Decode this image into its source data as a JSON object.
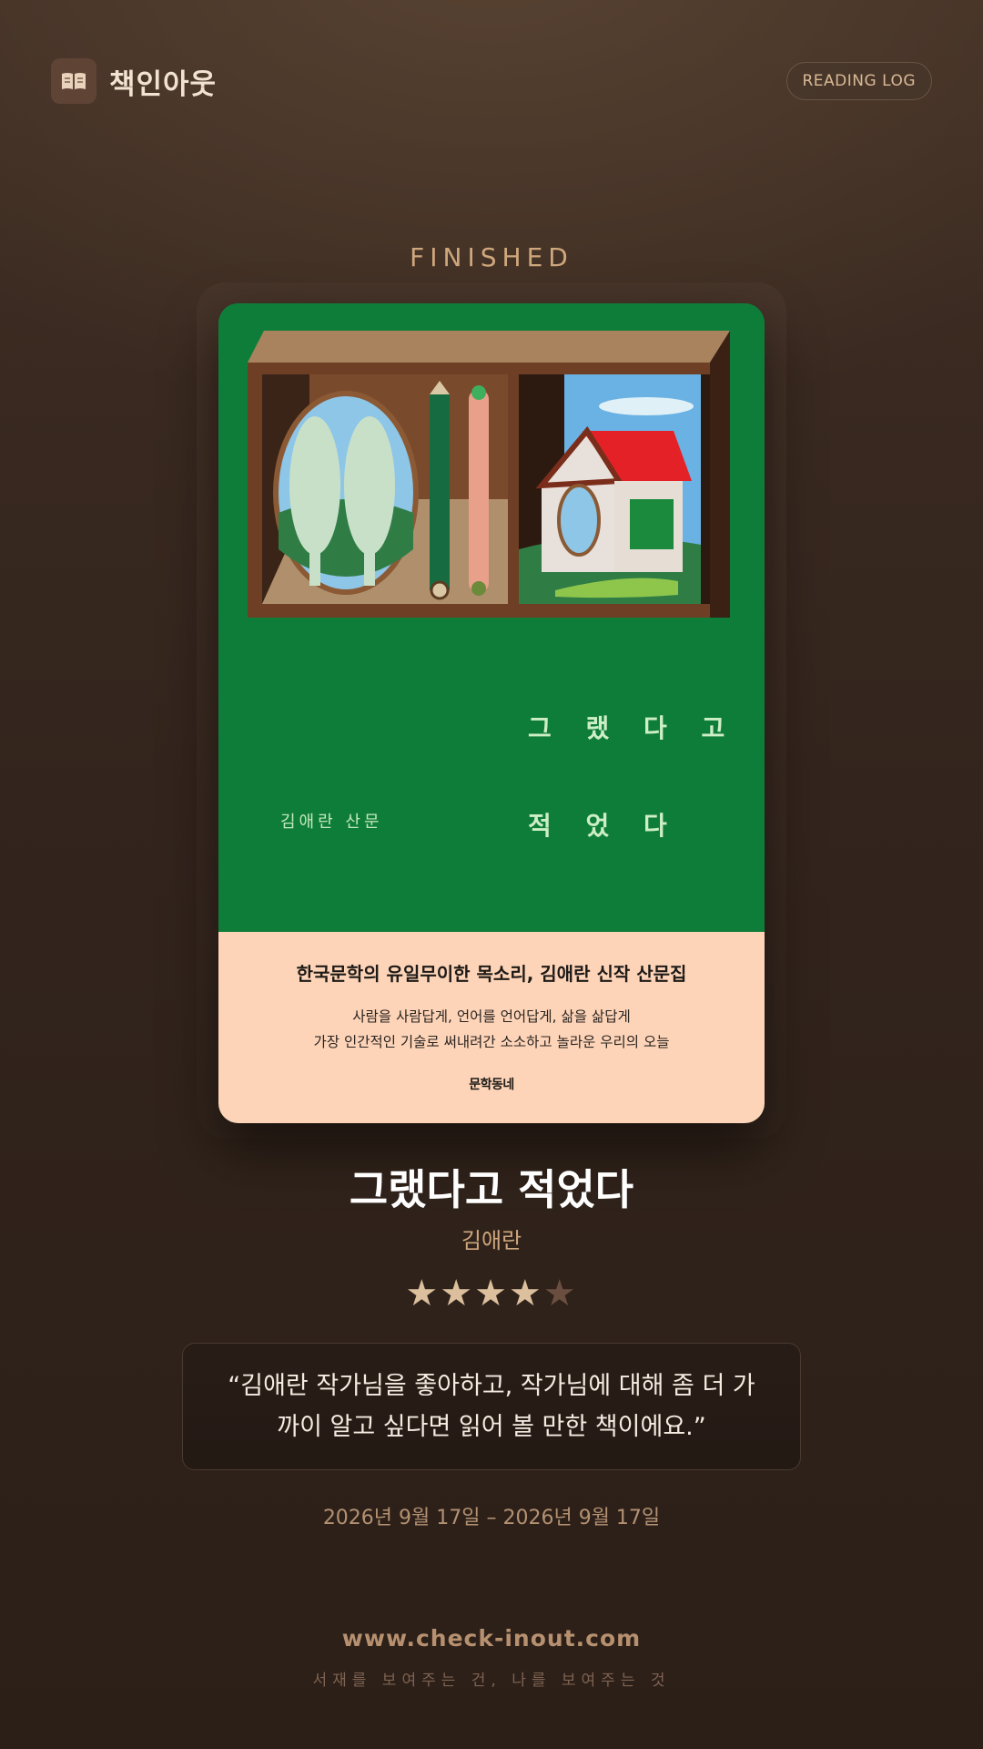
{
  "header": {
    "logo_icon": "open-book-icon",
    "brand_name": "책인아웃",
    "log_label": "READING LOG"
  },
  "status_label": "FINISHED",
  "book": {
    "cover": {
      "title_line1": "그 랬 다 고",
      "title_line2": "적 었 다",
      "author_line": "김애란 산문",
      "band_headline": "한국문학의 유일무이한 목소리, 김애란 신작 산문집",
      "band_line1": "사람을 사람답게, 언어를 언어답게, 삶을 삶답게",
      "band_line2": "가장 인간적인 기술로 써내려간 소소하고 놀라운 우리의 오늘",
      "publisher": "문학동네",
      "colors": {
        "green": "#0f7d3a",
        "band": "#fdd4b8"
      }
    },
    "title": "그랬다고 적었다",
    "author": "김애란",
    "rating": {
      "value": 4,
      "max": 5
    }
  },
  "review": {
    "quote": "“김애란 작가님을 좋아하고, 작가님에 대해 좀 더 가까이 알고 싶다면 읽어 볼 만한 책이에요.”"
  },
  "dates": "2026년 9월 17일 – 2026년 9월 17일",
  "footer": {
    "site": "www.check-inout.com",
    "tagline": "서재를 보여주는 건, 나를 보여주는 것"
  }
}
